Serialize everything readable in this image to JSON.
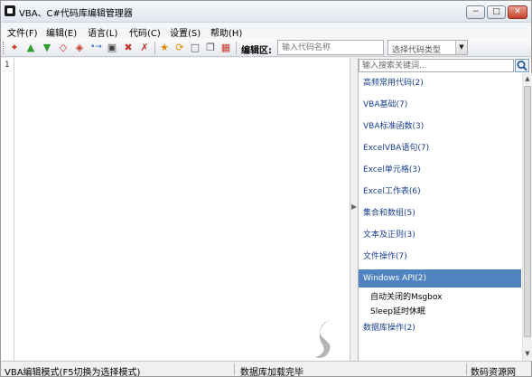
{
  "window": {
    "title": "VBA、C#代码库编辑管理器",
    "minimize": "−",
    "maximize": "□",
    "close": "✕"
  },
  "menu": [
    "文件(F)",
    "编辑(E)",
    "语言(L)",
    "代码(C)",
    "设置(S)",
    "帮助(H)"
  ],
  "toolbar": {
    "icons": [
      "add-code-icon",
      "move-up-icon",
      "move-down-icon",
      "copy-icon",
      "paste-icon",
      "link-icon",
      "save-icon",
      "delete-icon",
      "remove-icon",
      "bookmark-icon",
      "refresh-icon",
      "new-doc-icon",
      "copy-doc-icon",
      "export-icon"
    ],
    "edit_area_label": "编辑区:",
    "code_name_placeholder": "输入代码名称",
    "type_select_value": "选择代码类型"
  },
  "editor": {
    "first_line_number": "1"
  },
  "panel": {
    "search_placeholder": "输入搜索关键词...",
    "categories": [
      {
        "label": "高频常用代码(2)"
      },
      {
        "label": "VBA基础(7)"
      },
      {
        "label": "VBA标准函数(3)"
      },
      {
        "label": "ExcelVBA语句(7)"
      },
      {
        "label": "Excel单元格(3)"
      },
      {
        "label": "Excel工作表(6)"
      },
      {
        "label": "集合和数组(5)"
      },
      {
        "label": "文本及正则(3)"
      },
      {
        "label": "文件操作(7)"
      },
      {
        "label": "Windows API(2)",
        "selected": true
      },
      {
        "label": "数据库操作(2)"
      }
    ],
    "subitems": [
      "自动关闭的Msgbox",
      "Sleep延时休眠"
    ]
  },
  "status": {
    "mode": "VBA编辑模式(F5切换为选择模式)",
    "load": "数据库加载完毕",
    "right": "数码资源网"
  },
  "colors": {
    "selected_bg": "#4f84c0",
    "category_text": "#1a3f8f"
  }
}
